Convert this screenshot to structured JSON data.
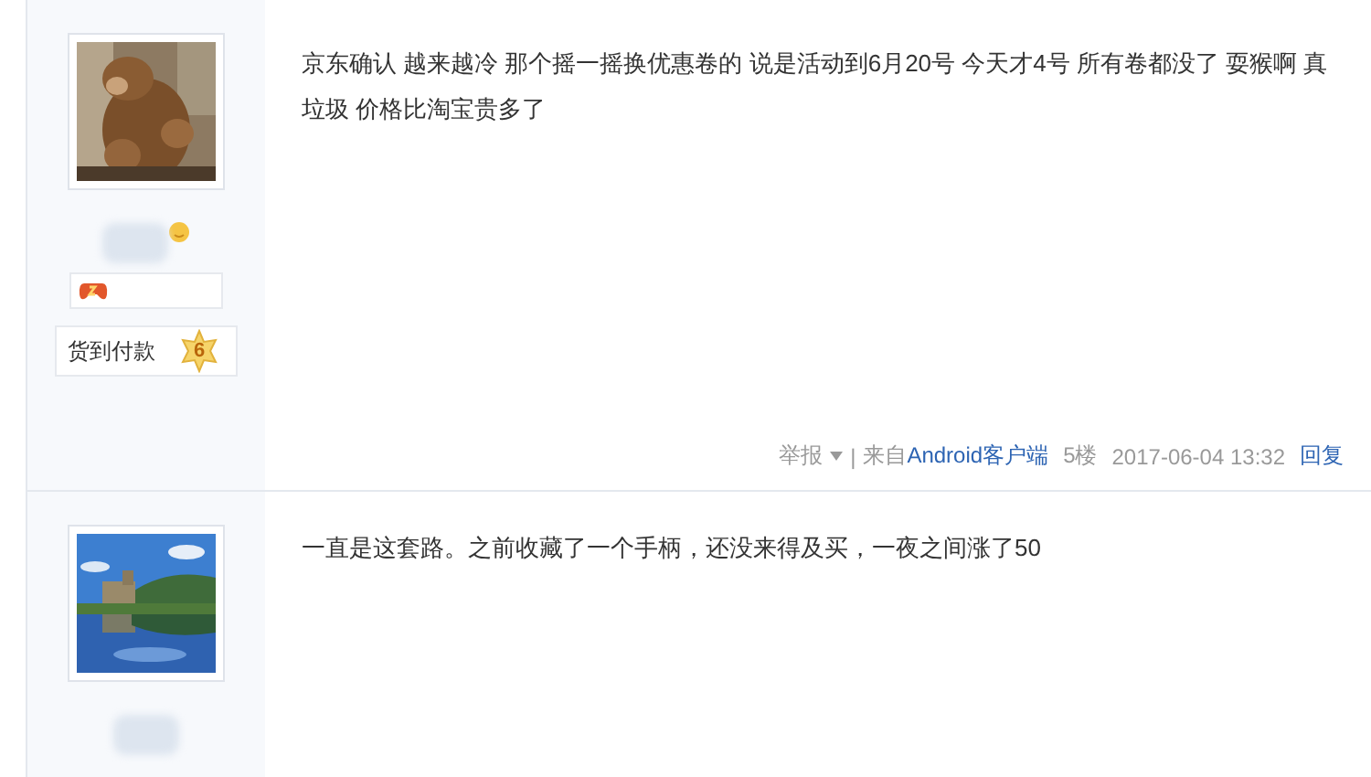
{
  "posts": [
    {
      "badges": [
        {
          "kind": "icon"
        },
        {
          "kind": "label",
          "text": "货到付款",
          "level_text": "6"
        }
      ],
      "content": "京东确认 越来越冷 那个摇一摇换优惠卷的 说是活动到6月20号 今天才4号 所有卷都没了 耍猴啊 真垃圾 价格比淘宝贵多了",
      "footer": {
        "report": "举报",
        "separator": "|",
        "source_prefix": "来自",
        "source_link": "Android客户端",
        "floor": "5楼",
        "time": "2017-06-04 13:32",
        "reply": "回复"
      }
    },
    {
      "content": "一直是这套路。之前收藏了一个手柄，还没来得及买，一夜之间涨了50"
    }
  ]
}
